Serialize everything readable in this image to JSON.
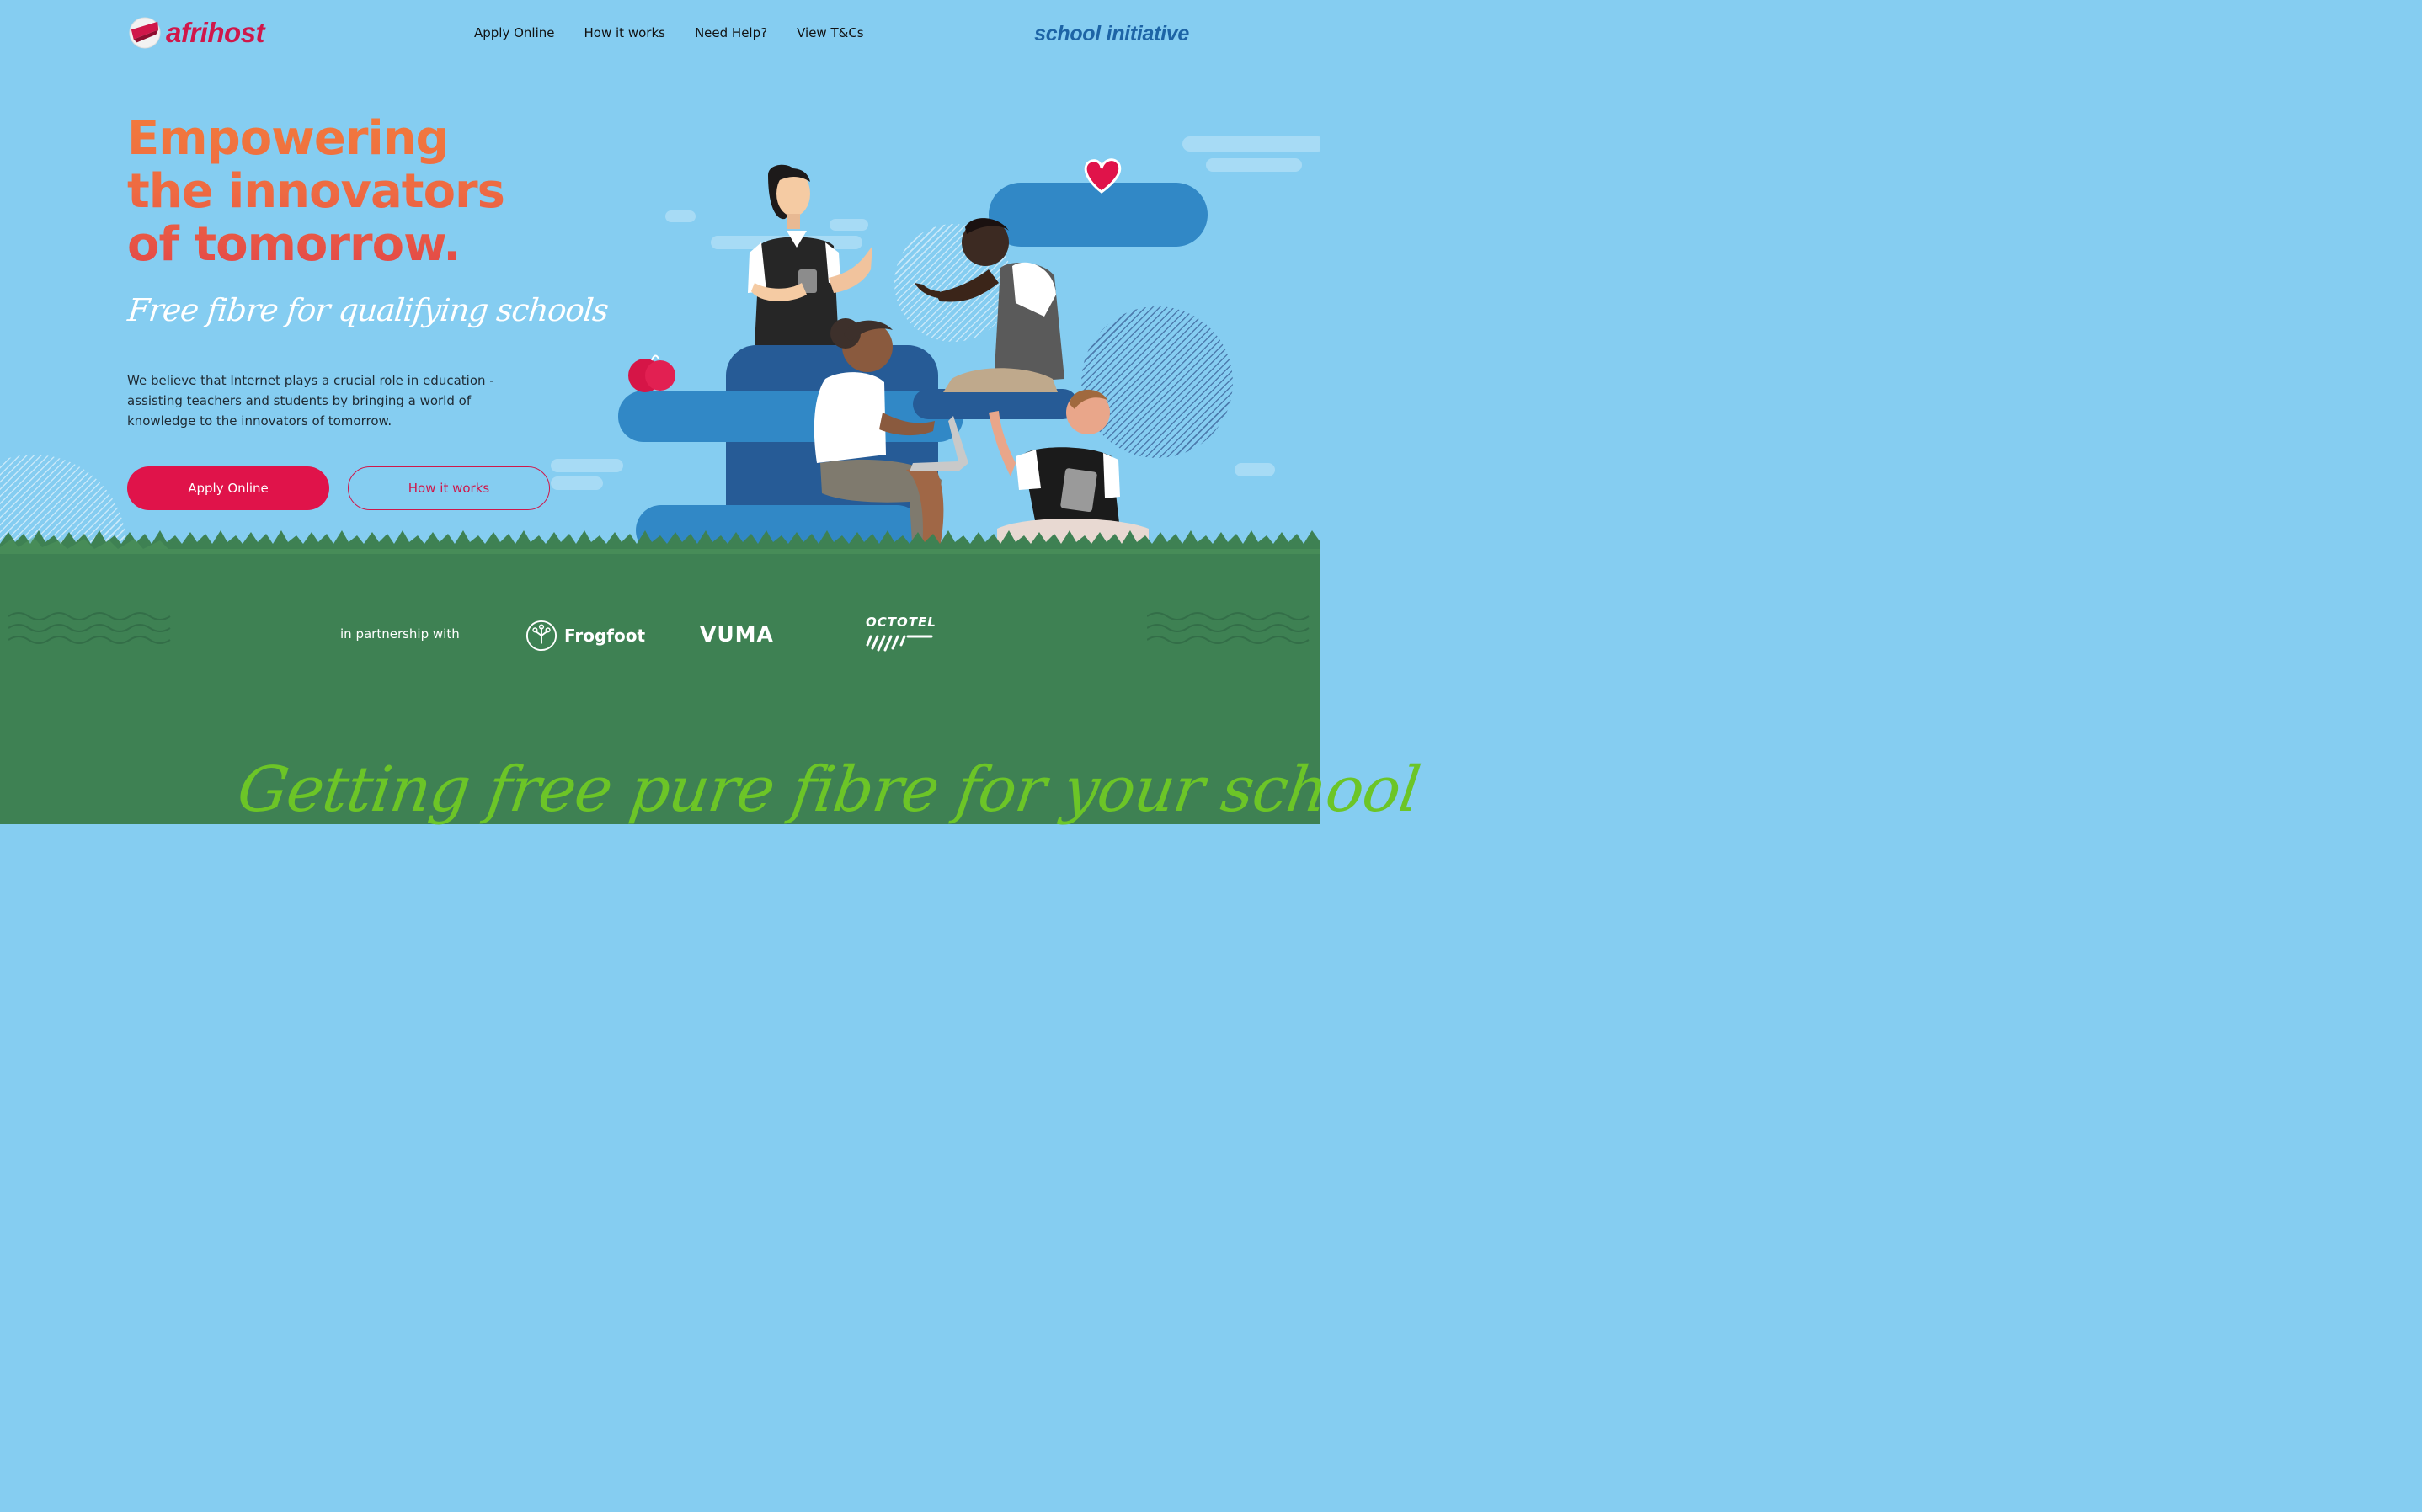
{
  "brand": {
    "name": "afrihost",
    "initiative": "school initiative",
    "primary_color": "#E0134A",
    "sky_color": "#85CDF1",
    "ground_color": "#3E8153",
    "accent_green": "#6CC527"
  },
  "nav": {
    "items": [
      {
        "label": "Apply Online"
      },
      {
        "label": "How it works"
      },
      {
        "label": "Need Help?"
      },
      {
        "label": "View T&Cs"
      }
    ]
  },
  "hero": {
    "headline_lines": [
      "Empowering",
      "the innovators",
      "of tomorrow."
    ],
    "tagline": "Free fibre for qualifying schools",
    "intro": "We believe that Internet plays a crucial role in education - assisting teachers and students by bringing a world of knowledge to the innovators of tomorrow.",
    "primary_button": "Apply Online",
    "secondary_button": "How it works",
    "illustration": "students-with-devices-illustration"
  },
  "partners": {
    "label": "in partnership with",
    "logos": [
      {
        "name": "Frogfoot",
        "icon": "frogfoot-logo"
      },
      {
        "name": "VUMA",
        "icon": "vuma-logo"
      },
      {
        "name": "OCTOTEL",
        "icon": "octotel-logo"
      }
    ]
  },
  "section": {
    "heading": "Getting free pure fibre for your school"
  }
}
